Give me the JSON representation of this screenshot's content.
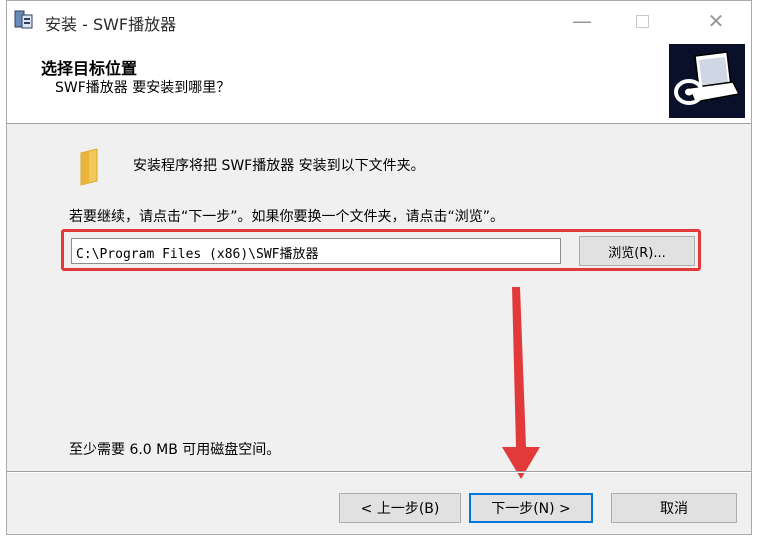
{
  "window": {
    "title": "安装 - SWF播放器",
    "controls": {
      "minimize": "—",
      "close": "✕"
    }
  },
  "header": {
    "title": "选择目标位置",
    "subtitle": "SWF播放器 要安装到哪里？",
    "image_icon": "computer-cd-icon"
  },
  "main": {
    "intro_text": "安装程序将把 SWF播放器 安装到以下文件夹。",
    "continue_text": "若要继续，请点击“下一步”。如果你要换一个文件夹，请点击“浏览”。",
    "path_value": "C:\\Program Files (x86)\\SWF播放器",
    "browse_label": "浏览(R)...",
    "space_text": "至少需要 6.0 MB 可用磁盘空间。",
    "folder_icon": "folder-icon"
  },
  "footer": {
    "back_label": "< 上一步(B)",
    "next_label": "下一步(N) >",
    "cancel_label": "取消"
  },
  "colors": {
    "annotation_red": "#e23a3a",
    "focus_blue": "#0078d7",
    "dialog_bg": "#f0f0f0",
    "header_image_bg": "#0a0f2a",
    "folder_yellow": "#f3c85a"
  }
}
